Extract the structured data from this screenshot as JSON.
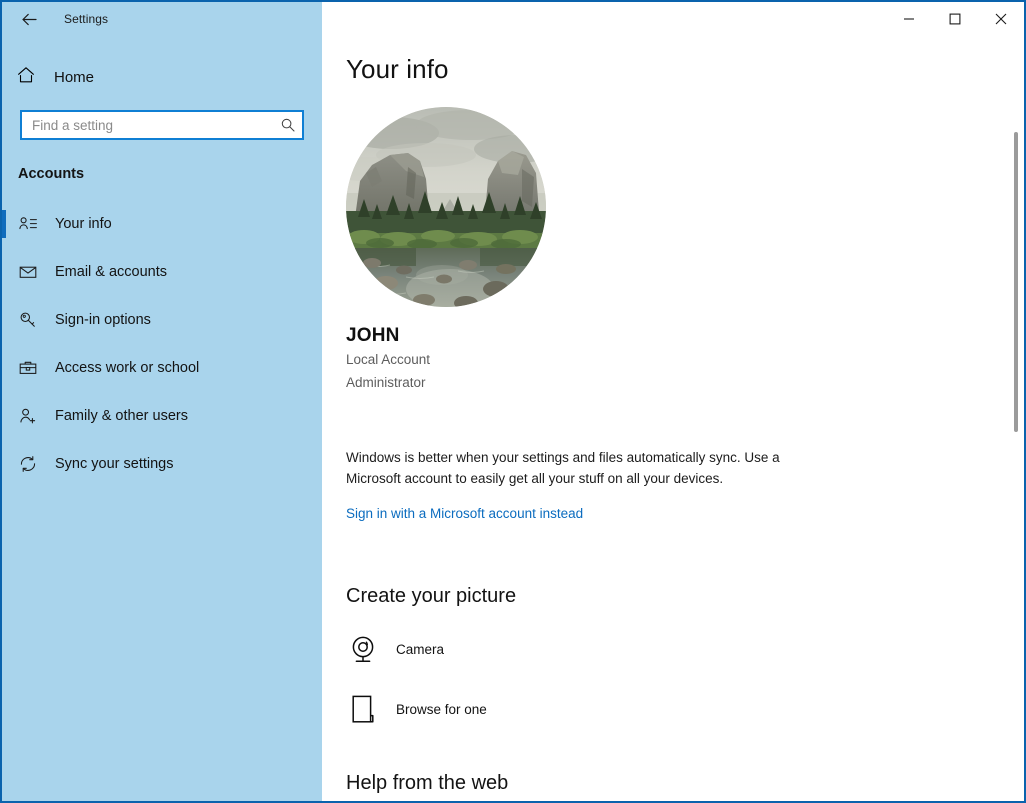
{
  "window": {
    "border_color": "#0a63ad",
    "controls": {
      "minimize": "minimize-button",
      "maximize": "maximize-button",
      "close": "close-button"
    }
  },
  "sidebar": {
    "background_color": "#a9d4ec",
    "app_title": "Settings",
    "back_label": "Back",
    "home_label": "Home",
    "search": {
      "placeholder": "Find a setting",
      "value": "",
      "accent_color": "#0f7fd4"
    },
    "section_header": "Accounts",
    "selected_index": 0,
    "selection_color": "#0f6cbd",
    "items": [
      {
        "label": "Your info",
        "icon": "user-card-icon",
        "selected": true
      },
      {
        "label": "Email & accounts",
        "icon": "envelope-icon",
        "selected": false
      },
      {
        "label": "Sign-in options",
        "icon": "key-icon",
        "selected": false
      },
      {
        "label": "Access work or school",
        "icon": "briefcase-icon",
        "selected": false
      },
      {
        "label": "Family & other users",
        "icon": "person-add-icon",
        "selected": false
      },
      {
        "label": "Sync your settings",
        "icon": "sync-icon",
        "selected": false
      }
    ]
  },
  "main": {
    "page_title": "Your info",
    "avatar": {
      "icon": "account-picture",
      "description": "Yosemite valley landscape photo",
      "shape": "circle"
    },
    "account": {
      "name": "JOHN",
      "type": "Local Account",
      "role": "Administrator"
    },
    "sync": {
      "description": "Windows is better when your settings and files automatically sync. Use a Microsoft account to easily get all your stuff on all your devices.",
      "link_text": "Sign in with a Microsoft account instead",
      "link_color": "#0b6cbf"
    },
    "create_picture": {
      "heading": "Create your picture",
      "options": [
        {
          "label": "Camera",
          "icon": "webcam-icon"
        },
        {
          "label": "Browse for one",
          "icon": "document-icon"
        }
      ]
    },
    "help": {
      "heading": "Help from the web"
    }
  }
}
